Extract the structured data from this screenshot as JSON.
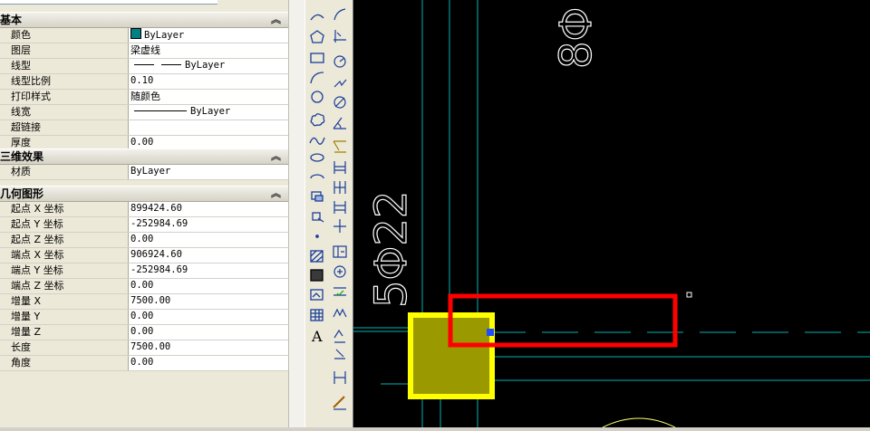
{
  "sections": [
    {
      "title": "基本",
      "rows": [
        {
          "key": "颜色",
          "value": "ByLayer",
          "swatch": "#008080"
        },
        {
          "key": "图层",
          "value": "梁虚线"
        },
        {
          "key": "线型",
          "value": "ByLayer",
          "line": "short"
        },
        {
          "key": "线型比例",
          "value": "0.10"
        },
        {
          "key": "打印样式",
          "value": "随颜色"
        },
        {
          "key": "线宽",
          "value": "ByLayer",
          "line": "long"
        },
        {
          "key": "超链接",
          "value": ""
        },
        {
          "key": "厚度",
          "value": "0.00"
        }
      ]
    },
    {
      "title": "三维效果",
      "rows": [
        {
          "key": "材质",
          "value": "ByLayer"
        }
      ]
    },
    {
      "title": "几何图形",
      "rows": [
        {
          "key": "起点 X 坐标",
          "value": "899424.60"
        },
        {
          "key": "起点 Y 坐标",
          "value": "-252984.69"
        },
        {
          "key": "起点 Z 坐标",
          "value": "0.00"
        },
        {
          "key": "端点 X 坐标",
          "value": "906924.60"
        },
        {
          "key": "端点 Y 坐标",
          "value": "-252984.69"
        },
        {
          "key": "端点 Z 坐标",
          "value": "0.00"
        },
        {
          "key": "增量 X",
          "value": "7500.00"
        },
        {
          "key": "增量 Y",
          "value": "0.00"
        },
        {
          "key": "增量 Z",
          "value": "0.00"
        },
        {
          "key": "长度",
          "value": "7500.00"
        },
        {
          "key": "角度",
          "value": "0.00"
        }
      ]
    }
  ],
  "drawing": {
    "label_left": "5Φ22",
    "label_top": "8Φ"
  },
  "colors": {
    "cad_background": "#000000",
    "cyan_line": "#00c8c8",
    "grip_yellow": "#ffff00",
    "grip_fill": "#9a9a00",
    "highlight_red": "#ff0000",
    "grip_blue": "#1f4cff"
  },
  "icons_toolbar1": [
    "arc-icon",
    "polygon-icon",
    "rectangle-icon",
    "arc2-icon",
    "circle-icon",
    "revcloud-icon",
    "spline-icon",
    "ellipse-icon",
    "ellipse-arc-icon",
    "insert-block-icon",
    "make-block-icon",
    "point-icon",
    "hatch-icon",
    "gradient-icon",
    "region-icon",
    "table-icon",
    "mtext-icon"
  ],
  "icons_toolbar2": [
    "dim-arc-icon",
    "dim-ordinate-icon",
    "dim-radius-icon",
    "dim-jogged-icon",
    "dim-diameter-icon",
    "dim-angular-icon",
    "quick-dim-icon",
    "dim-baseline-icon",
    "dim-continue-icon",
    "dim-space-icon",
    "dim-break-icon",
    "tolerance-icon",
    "center-mark-icon",
    "inspection-icon",
    "jogged-linear-icon",
    "dim-edit-icon",
    "dim-text-edit-icon",
    "dim-update-icon",
    "dim-style-icon"
  ]
}
